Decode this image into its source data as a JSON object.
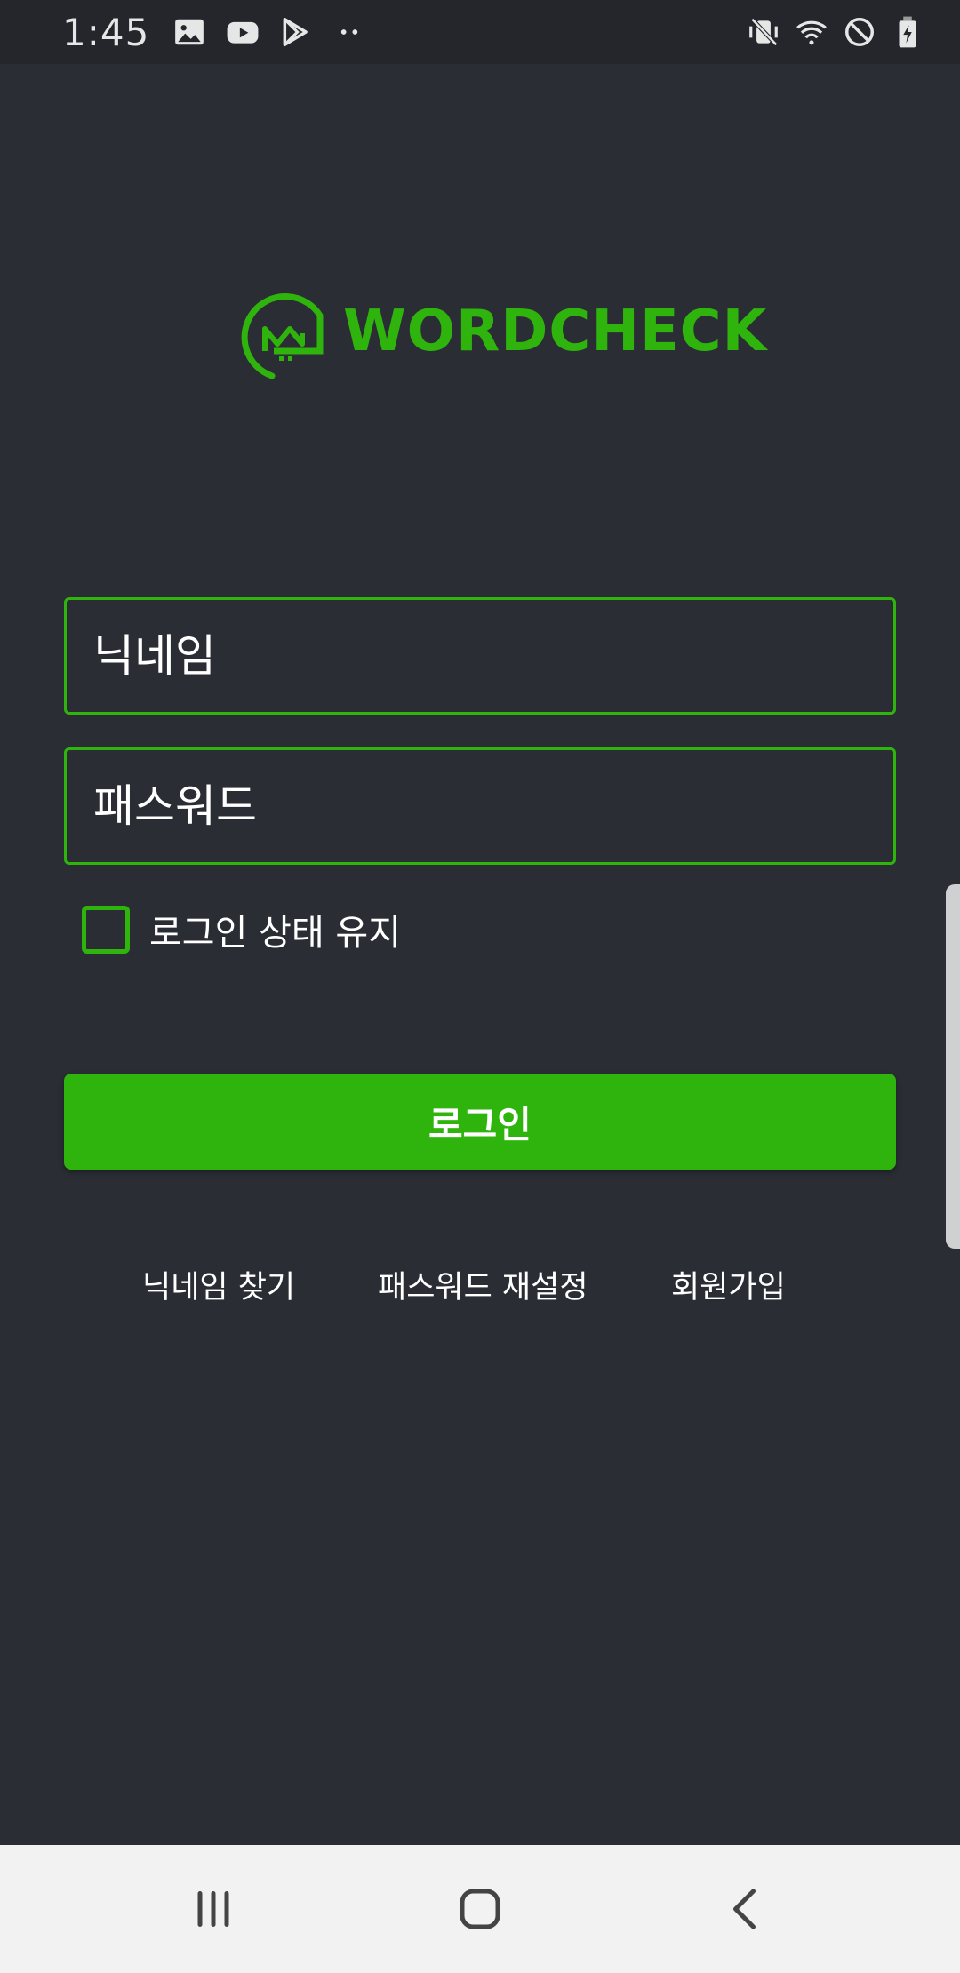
{
  "status_bar": {
    "time": "1:45",
    "left_icons": [
      "image-icon",
      "youtube-icon",
      "play-store-icon",
      "more-dots-icon"
    ],
    "right_icons": [
      "vibrate-mute-icon",
      "wifi-icon",
      "do-not-disturb-icon",
      "battery-charging-icon"
    ]
  },
  "logo": {
    "text": "WORDCHECK",
    "color": "#2fb40e"
  },
  "form": {
    "nickname_placeholder": "닉네임",
    "password_placeholder": "패스워드",
    "remember_label": "로그인 상태 유지",
    "login_label": "로그인"
  },
  "links": {
    "find_nickname": "닉네임 찾기",
    "reset_password": "패스워드 재설정",
    "signup": "회원가입"
  },
  "nav_bar": {
    "buttons": [
      "recent-apps-icon",
      "home-icon",
      "back-icon"
    ]
  },
  "colors": {
    "accent": "#2fb40e",
    "background": "#2b2d35",
    "status_bar": "#24262c",
    "nav_bar": "#f2f2f2"
  }
}
